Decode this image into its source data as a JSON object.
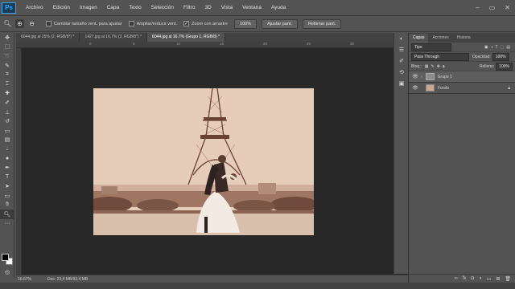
{
  "app": {
    "logo": "Ps"
  },
  "menu": [
    "Archivo",
    "Edición",
    "Imagen",
    "Capa",
    "Texto",
    "Selección",
    "Filtro",
    "3D",
    "Vista",
    "Ventana",
    "Ayuda"
  ],
  "window_controls": [
    "–",
    "▭",
    "✕"
  ],
  "options": {
    "resize_windows": "Cambiar tamaño vent. para ajustar",
    "zoom_all": "Ampliar/reducir vent.",
    "scrubby_zoom": "Zoom con arrastre",
    "zoom_value": "100%",
    "fit_screen": "Ajustar pant.",
    "fill_screen": "Rellenar pant."
  },
  "tabs": [
    {
      "label": "6044.jpg al 25% (2, RGB/8*) *",
      "active": false
    },
    {
      "label": "1427.jpg al 16.7% (2, RGB/8*) *",
      "active": false
    },
    {
      "label": "6044.jpg al 16.7% (Grupo 1, RGB/8) *",
      "active": true
    }
  ],
  "ruler": {
    "marks": [
      "0",
      "5",
      "10",
      "15",
      "20",
      "25",
      "30"
    ]
  },
  "status": {
    "zoom": "16.67%",
    "doc": "Doc: 23,4 MB/93,4 MB"
  },
  "panel": {
    "tabs": [
      "Capas",
      "Acciones",
      "Historia"
    ],
    "filter_kind": "Tipo",
    "blend_mode": "Pass Through",
    "opacity_label": "Opacidad:",
    "opacity_value": "100%",
    "lock_label": "Bloq.:",
    "fill_label": "Relleno:",
    "fill_value": "100%",
    "layers": [
      {
        "name": "Grupo 1",
        "selected": true
      },
      {
        "name": "Fondo",
        "selected": false
      }
    ]
  },
  "colors": {
    "accent": "#31a8ff",
    "foreground": "#000000",
    "background": "#ffffff"
  }
}
